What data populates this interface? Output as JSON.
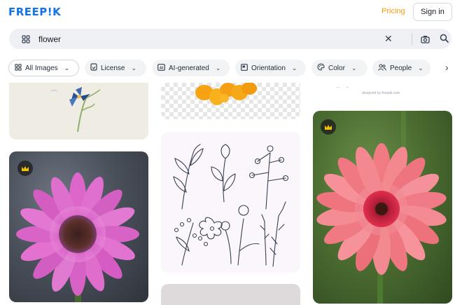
{
  "header": {
    "logo": "FREEP!K",
    "pricing": "Pricing",
    "signin": "Sign in"
  },
  "search": {
    "query": "flower",
    "icons": [
      "image-grid-icon",
      "clear-icon",
      "camera-icon",
      "search-icon"
    ]
  },
  "filters": [
    {
      "label": "All Images",
      "icon": "image-grid-icon"
    },
    {
      "label": "License",
      "icon": "license-icon"
    },
    {
      "label": "AI-generated",
      "icon": "ai-icon"
    },
    {
      "label": "Orientation",
      "icon": "orientation-icon"
    },
    {
      "label": "Color",
      "icon": "palette-icon"
    },
    {
      "label": "People",
      "icon": "people-icon"
    }
  ],
  "results": {
    "watermark": "designed by freepik.com"
  },
  "colors": {
    "brand": "#1273eb",
    "pricing": "#f59e0b",
    "premium_crown": "#f5c400"
  }
}
